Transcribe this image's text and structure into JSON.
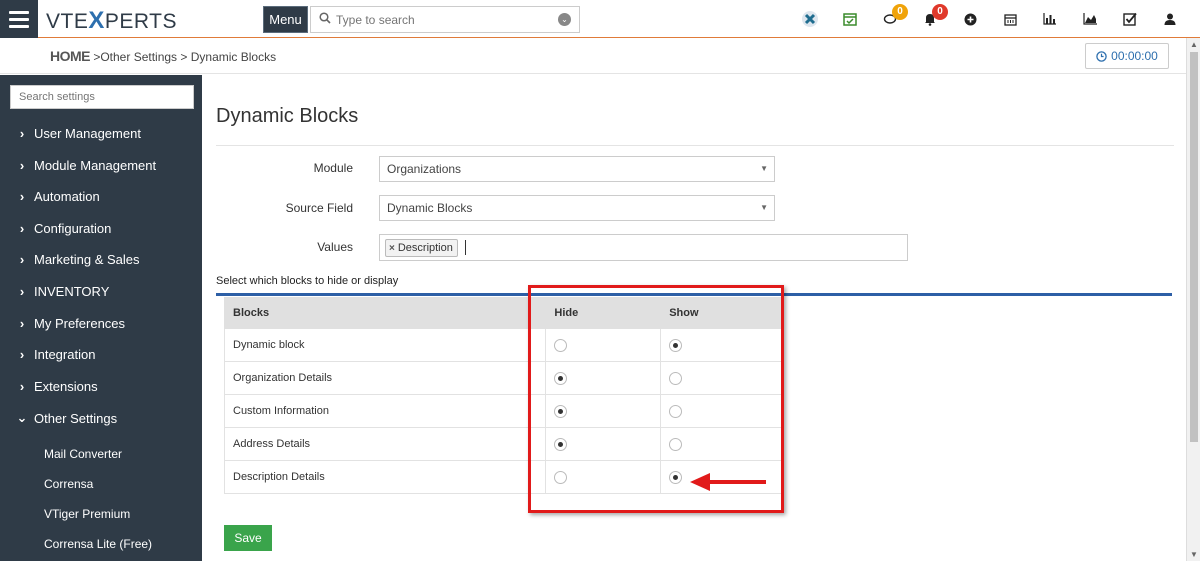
{
  "header": {
    "logo_left": "VTE",
    "logo_x": "X",
    "logo_right": "PERTS",
    "menu_label": "Menu",
    "search_placeholder": "Type to search",
    "notifications_count": "0",
    "alerts_count": "0"
  },
  "breadcrumb": {
    "home": "HOME",
    "sep1": " >",
    "other_settings": "Other Settings",
    "sep2": " > ",
    "current": "Dynamic Blocks"
  },
  "timer": {
    "value": "00:00:00"
  },
  "sidebar": {
    "search_placeholder": "Search settings",
    "items": [
      {
        "label": "User Management",
        "chev": "›"
      },
      {
        "label": "Module Management",
        "chev": "›"
      },
      {
        "label": "Automation",
        "chev": "›"
      },
      {
        "label": "Configuration",
        "chev": "›"
      },
      {
        "label": "Marketing & Sales",
        "chev": "›"
      },
      {
        "label": "INVENTORY",
        "chev": "›"
      },
      {
        "label": "My Preferences",
        "chev": "›"
      },
      {
        "label": "Integration",
        "chev": "›"
      },
      {
        "label": "Extensions",
        "chev": "›"
      },
      {
        "label": "Other Settings",
        "chev": "⌄"
      }
    ],
    "sub_items": [
      {
        "label": "Mail Converter"
      },
      {
        "label": "Corrensa"
      },
      {
        "label": "VTiger Premium"
      },
      {
        "label": "Corrensa Lite (Free)"
      }
    ]
  },
  "page": {
    "title": "Dynamic Blocks",
    "module_label": "Module",
    "module_value": "Organizations",
    "source_field_label": "Source Field",
    "source_field_value": "Dynamic Blocks",
    "values_label": "Values",
    "values_tag": "Description",
    "section_label": "Select which blocks to hide or display",
    "save_label": "Save"
  },
  "blocks_table": {
    "headers": {
      "blocks": "Blocks",
      "hide": "Hide",
      "show": "Show"
    },
    "rows": [
      {
        "name": "Dynamic block",
        "selected": "show"
      },
      {
        "name": "Organization Details",
        "selected": "hide"
      },
      {
        "name": "Custom Information",
        "selected": "hide"
      },
      {
        "name": "Address Details",
        "selected": "hide"
      },
      {
        "name": "Description Details",
        "selected": "show"
      }
    ]
  },
  "colors": {
    "sidebar_bg": "#2f3b47",
    "highlight_box": "#e11a1a",
    "save_button": "#3aa44b",
    "section_rule": "#2d5fa6"
  }
}
